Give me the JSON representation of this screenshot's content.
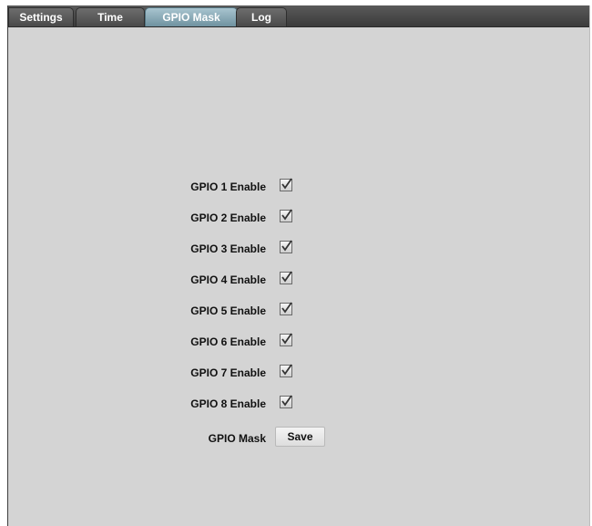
{
  "tabs": [
    {
      "label": "Settings",
      "active": false
    },
    {
      "label": "Time",
      "active": false
    },
    {
      "label": "GPIO Mask",
      "active": true
    },
    {
      "label": "Log",
      "active": false
    }
  ],
  "gpio": [
    {
      "label": "GPIO 1 Enable",
      "checked": true
    },
    {
      "label": "GPIO 2 Enable",
      "checked": true
    },
    {
      "label": "GPIO 3 Enable",
      "checked": true
    },
    {
      "label": "GPIO 4 Enable",
      "checked": true
    },
    {
      "label": "GPIO 5 Enable",
      "checked": true
    },
    {
      "label": "GPIO 6 Enable",
      "checked": true
    },
    {
      "label": "GPIO 7 Enable",
      "checked": true
    },
    {
      "label": "GPIO 8 Enable",
      "checked": true
    }
  ],
  "mask": {
    "label": "GPIO Mask",
    "save_label": "Save"
  },
  "colors": {
    "tab_active": "#7fa3b1",
    "tab_inactive": "#555555",
    "panel_background": "#d4d4d4"
  }
}
